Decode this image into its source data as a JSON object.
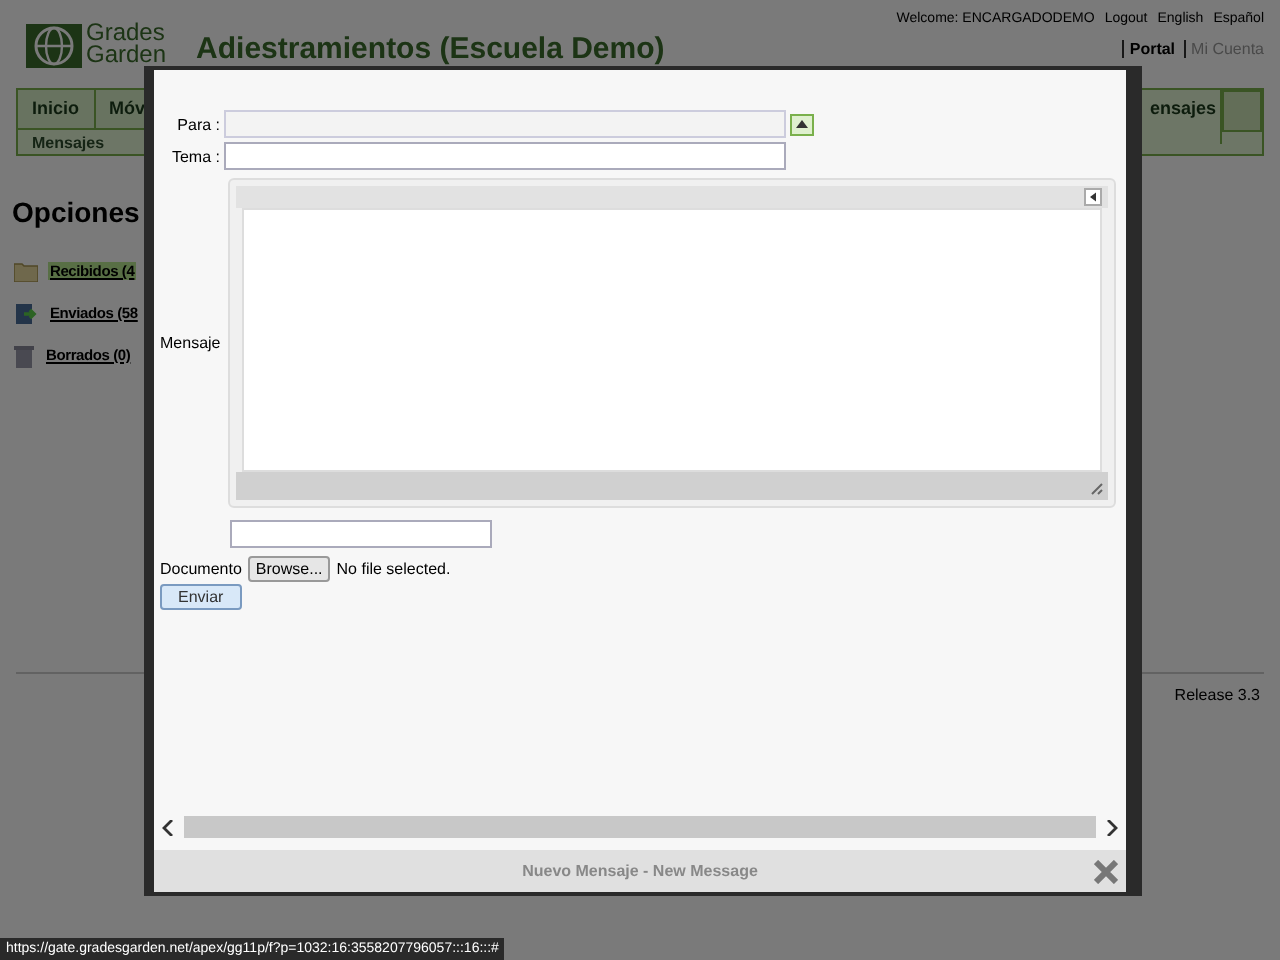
{
  "header": {
    "logo_lines": [
      "Grades",
      "Garden"
    ],
    "title": "Adiestramientos (Escuela Demo)",
    "welcome": "Welcome: ENCARGADODEMO",
    "links": [
      "Logout",
      "English",
      "Español"
    ],
    "account_links": [
      {
        "label": "Portal",
        "selected": true
      },
      {
        "label": "Mi Cuenta",
        "selected": false
      }
    ]
  },
  "nav": {
    "tabs": [
      {
        "label": "Inicio",
        "selected": false
      },
      {
        "label": "Móv",
        "selected": false
      },
      {
        "label": "ensajes",
        "selected": true
      }
    ],
    "subtabs": [
      "Mensajes"
    ]
  },
  "sidebar": {
    "title": "Opciones",
    "items": [
      {
        "label": "Recibidos (4",
        "selected": true,
        "kind": "folder"
      },
      {
        "label": "Enviados (58",
        "selected": false,
        "kind": "sent"
      },
      {
        "label": "Borrados (0)",
        "selected": false,
        "kind": "trash"
      }
    ]
  },
  "footer": {
    "release": "Release 3.3"
  },
  "dialog": {
    "title": "Nuevo Mensaje - New Message",
    "form": {
      "to_label": "Para :",
      "subject_label": "Tema :",
      "message_label": "Mensaje",
      "document_label": "Documento",
      "browse_button": "Browse...",
      "file_status": "No file selected.",
      "send_button": "Enviar"
    }
  },
  "status_bar": {
    "url": "https://gate.gradesgarden.net/apex/gg11p/f?p=1032:16:3558207796057:::16:::#"
  }
}
